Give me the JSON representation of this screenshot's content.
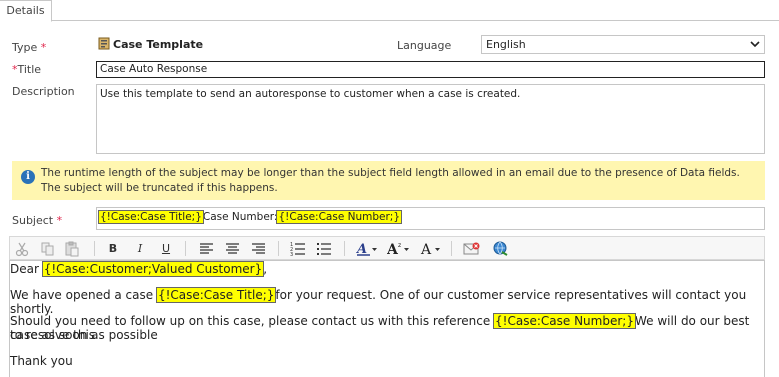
{
  "tabs": {
    "details": "Details"
  },
  "form": {
    "type_label": "Type",
    "type_value": "Case Template",
    "language_label": "Language",
    "language_value": "English",
    "title_label": "Title",
    "title_value": "Case Auto Response",
    "description_label": "Description",
    "description_value": "Use this template to send an autoresponse to customer when a case is created.",
    "required_marker": "*"
  },
  "notice": {
    "text": "The runtime length of the subject may be longer than the subject field length allowed in an email due to the presence of Data fields. The subject will be truncated if this happens."
  },
  "subject": {
    "label": "Subject",
    "token1": "{!Case:Case Title;}",
    "middle": "Case Number:",
    "token2": "{!Case:Case Number;}"
  },
  "toolbar": {
    "bold": "B",
    "italic": "I",
    "underline": "U"
  },
  "email_body": {
    "line1_prefix": "Dear ",
    "line1_token": "{!Case:Customer;Valued Customer}",
    "line1_suffix": ",",
    "line2_prefix": "We have opened a case ",
    "line2_token": "{!Case:Case Title;}",
    "line2_suffix": "for your request. One of our customer service representatives will contact you shortly.",
    "line3_prefix": "Should you need to follow up on this case, please contact us with this reference ",
    "line3_token": "{!Case:Case Number;}",
    "line3_suffix": "We will do our best to resolve this",
    "line3_cont": "case as soon as possible",
    "line4": "Thank you"
  },
  "colors": {
    "highlight": "#ffff00",
    "notice_bg": "#fff6b0",
    "required": "#e0254b"
  }
}
